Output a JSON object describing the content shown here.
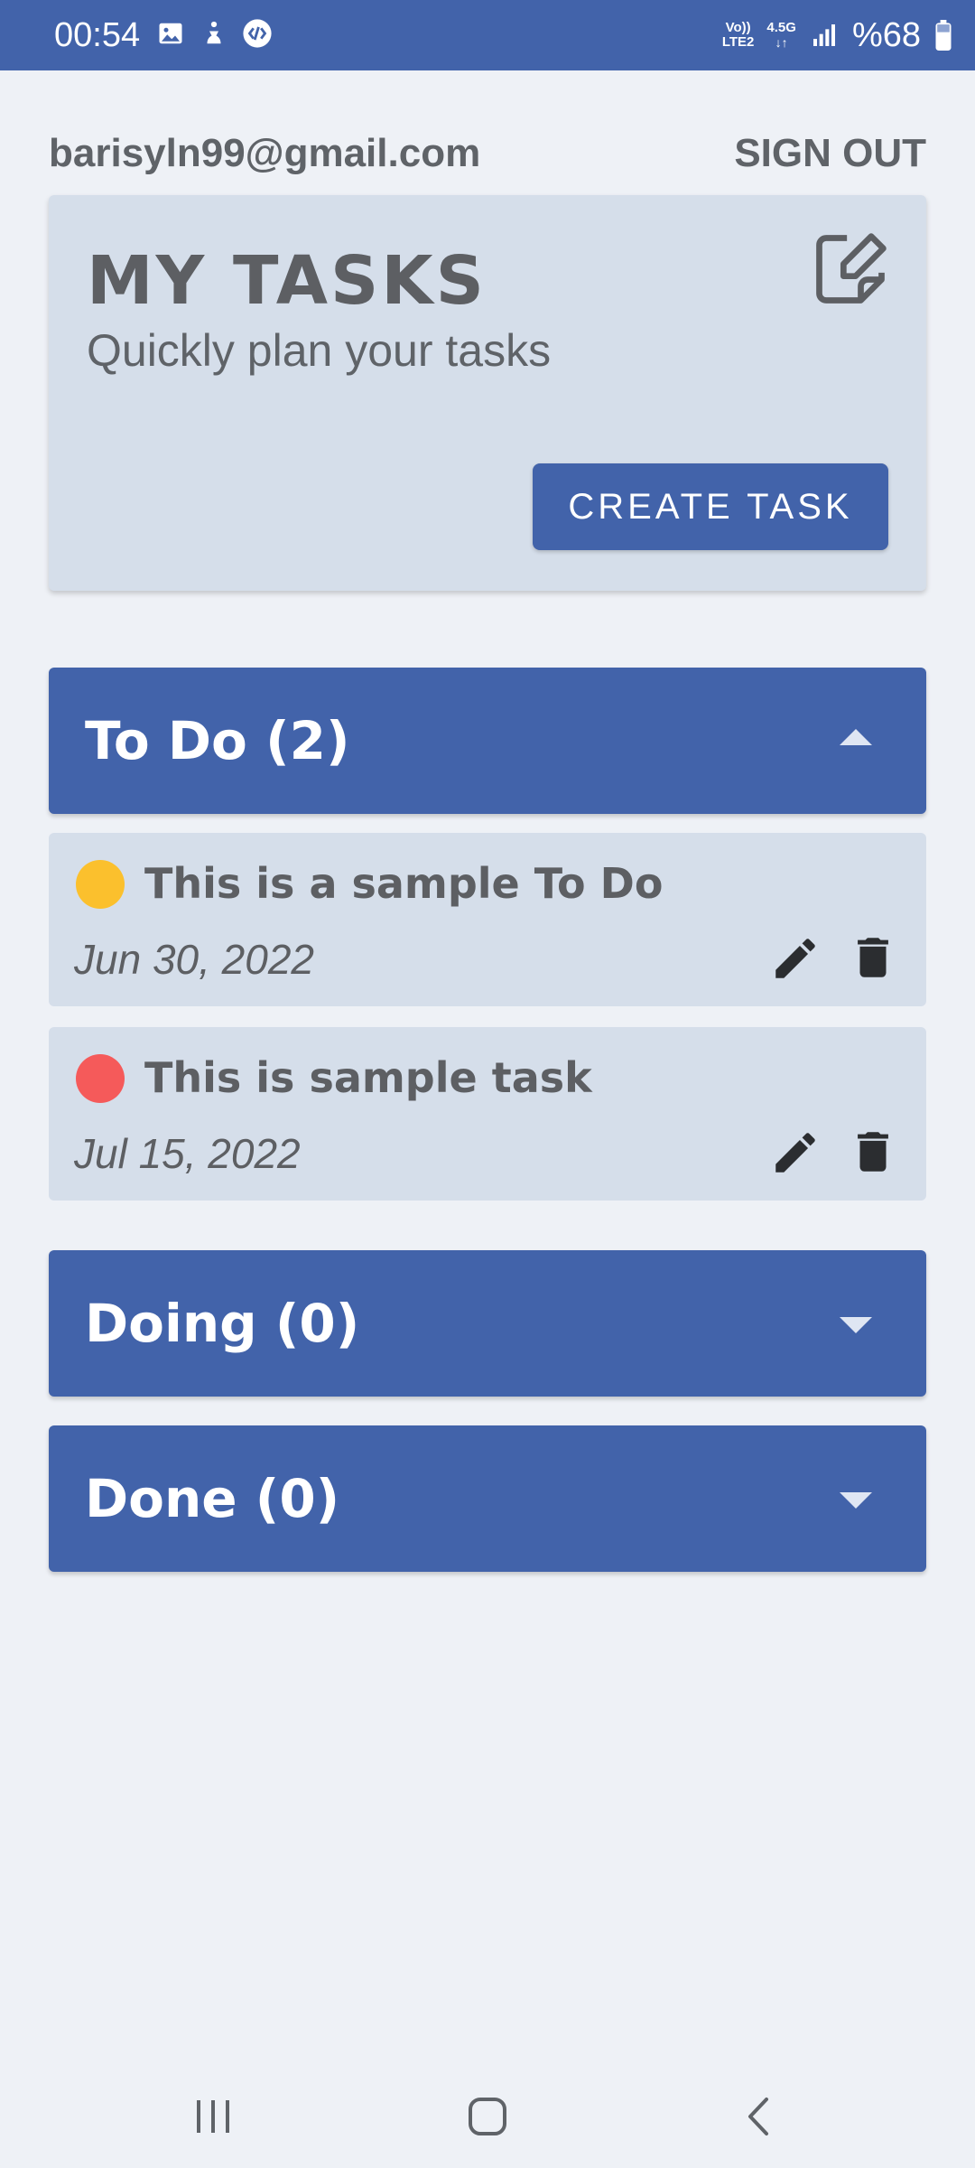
{
  "status_bar": {
    "time": "00:54",
    "network_top": "Vo))",
    "network_bottom": "LTE2",
    "network_gen": "4.5G",
    "battery": "%68",
    "left_icons": [
      "gallery-icon",
      "accessibility-icon",
      "shazam-icon"
    ],
    "right_icons": [
      "signal-icon",
      "battery-icon"
    ]
  },
  "account": {
    "email": "barisyln99@gmail.com",
    "sign_out_label": "SIGN OUT"
  },
  "header": {
    "title": "MY TASKS",
    "subtitle": "Quickly plan your tasks",
    "icon": "edit-note-icon",
    "create_label": "CREATE TASK"
  },
  "sections": {
    "todo": {
      "title": "To Do (2)",
      "expanded": true
    },
    "doing": {
      "title": "Doing (0)",
      "expanded": false
    },
    "done": {
      "title": "Done (0)",
      "expanded": false
    }
  },
  "tasks": [
    {
      "title": "This is a sample To Do",
      "date": "Jun 30, 2022",
      "priority_color": "#fbc02d"
    },
    {
      "title": "This is sample task",
      "date": "Jul 15, 2022",
      "priority_color": "#f55a5a"
    }
  ],
  "colors": {
    "primary": "#4263aa",
    "card": "#d5deea",
    "background": "#eef1f6",
    "text_gray": "#5f6368"
  },
  "nav": {
    "icons": [
      "recent-apps-icon",
      "home-icon",
      "back-icon"
    ]
  }
}
